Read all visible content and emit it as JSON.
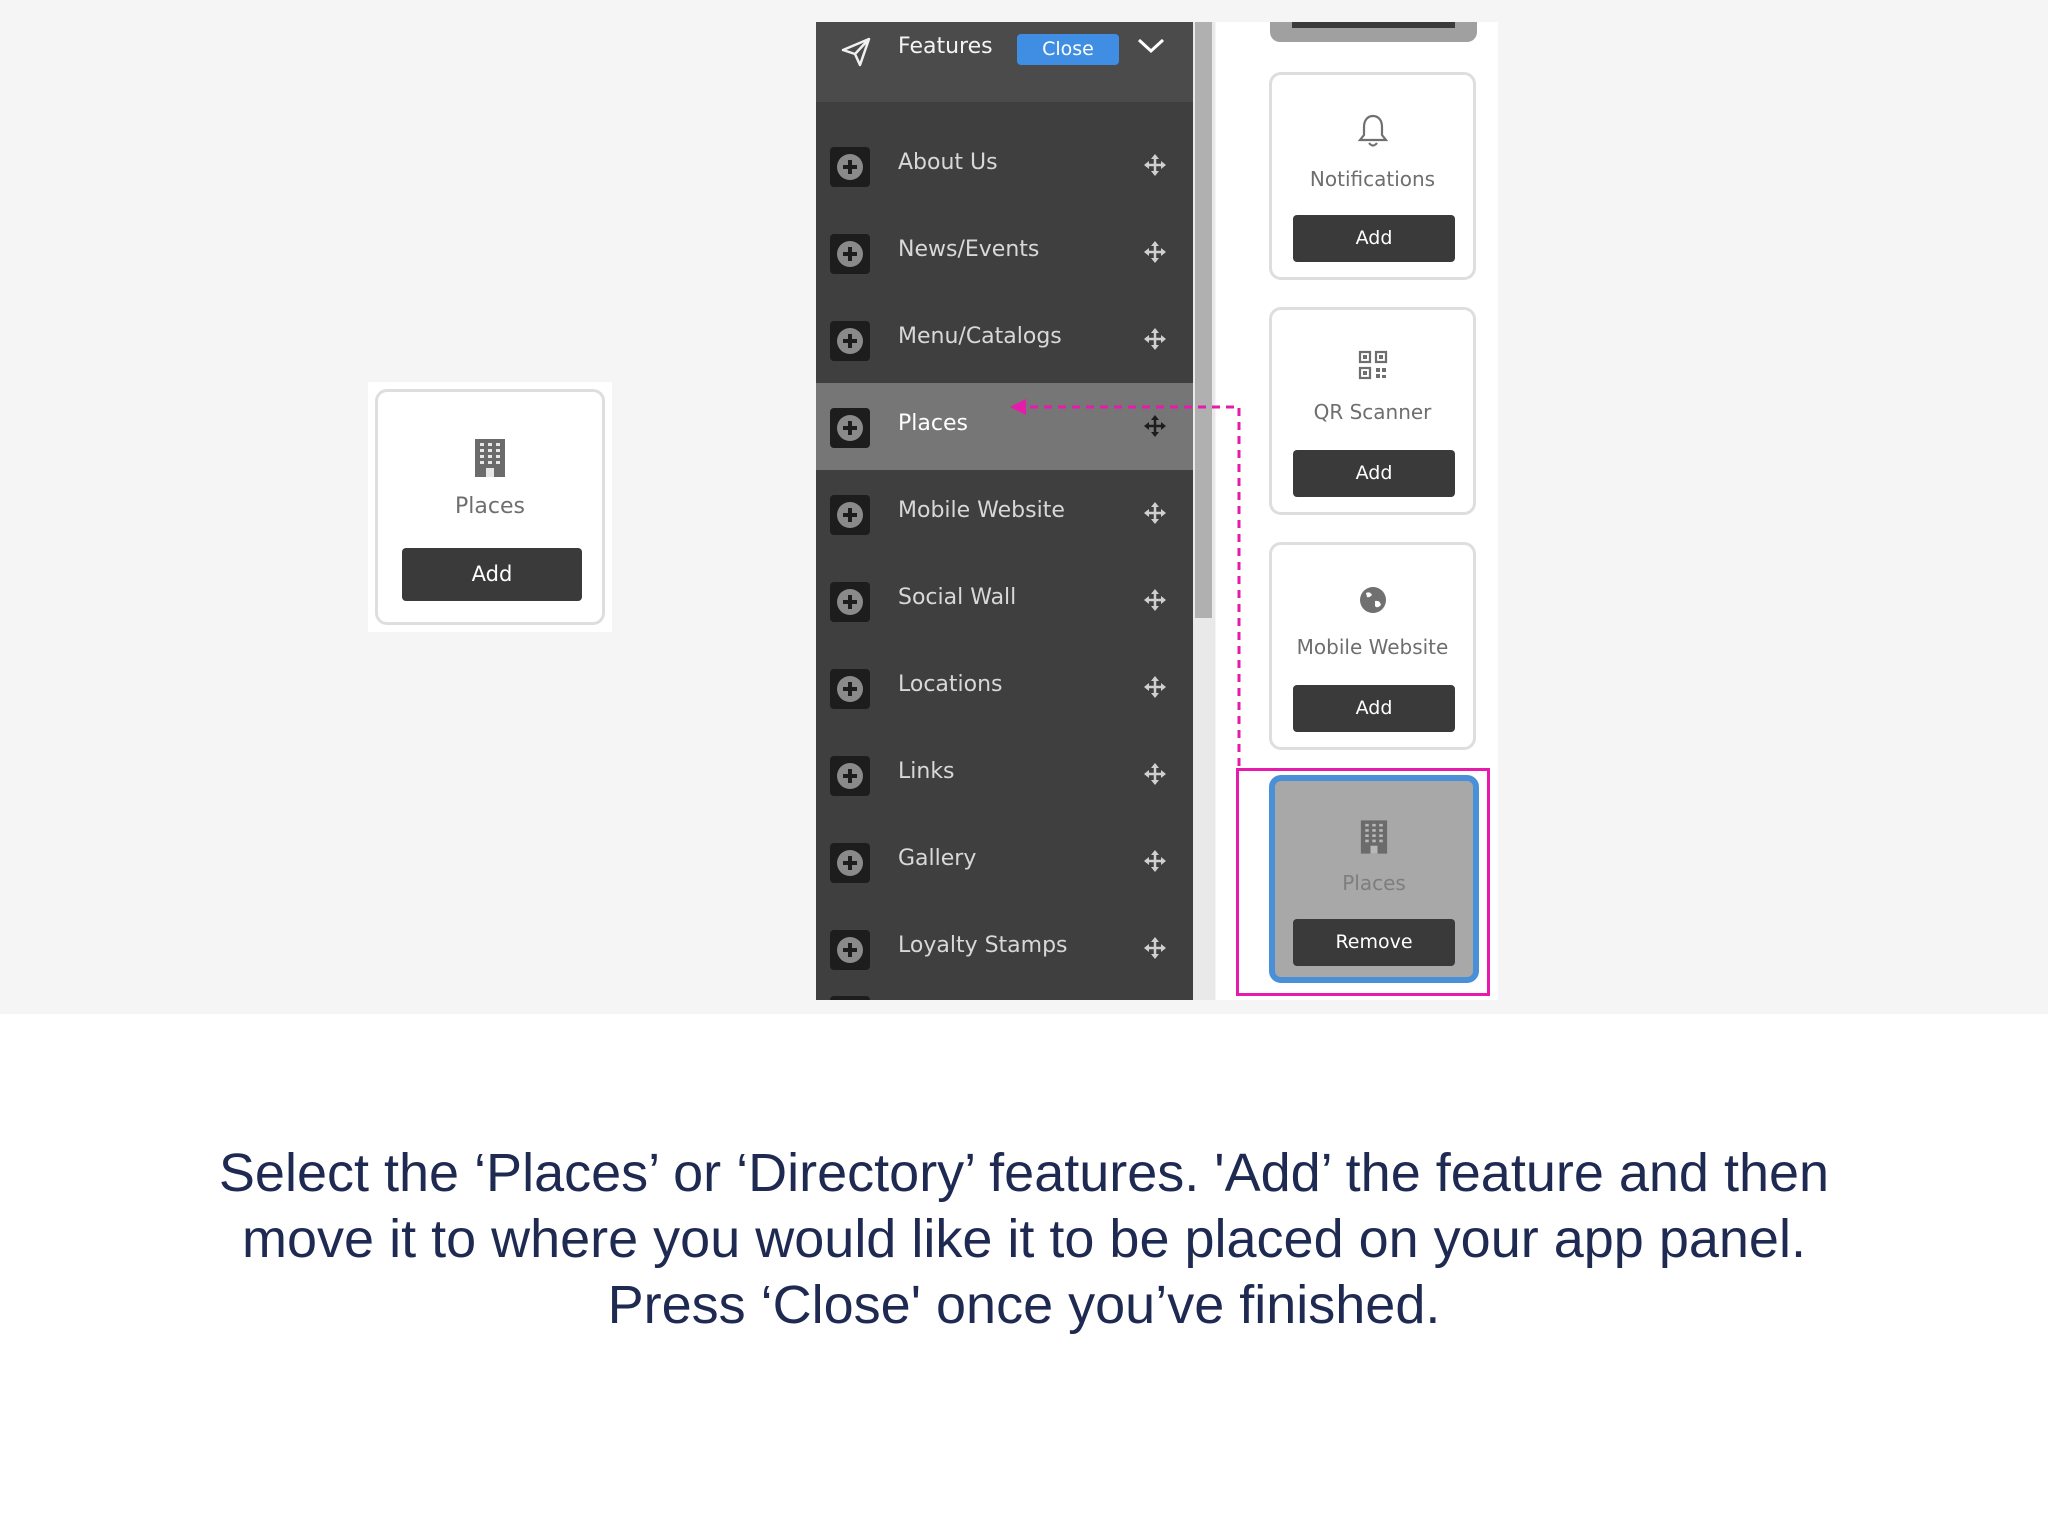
{
  "standalone_card": {
    "label": "Places",
    "button": "Add"
  },
  "menu": {
    "title": "Features",
    "close_label": "Close",
    "items": [
      {
        "label": "About Us"
      },
      {
        "label": "News/Events"
      },
      {
        "label": "Menu/Catalogs"
      },
      {
        "label": "Places",
        "active": true
      },
      {
        "label": "Mobile Website"
      },
      {
        "label": "Social Wall"
      },
      {
        "label": "Locations"
      },
      {
        "label": "Links"
      },
      {
        "label": "Gallery"
      },
      {
        "label": "Loyalty Stamps"
      }
    ]
  },
  "feature_cards": [
    {
      "label": "Notifications",
      "button": "Add",
      "icon": "bell-icon"
    },
    {
      "label": "QR Scanner",
      "button": "Add",
      "icon": "qr-code-icon"
    },
    {
      "label": "Mobile Website",
      "button": "Add",
      "icon": "globe-icon"
    }
  ],
  "placed_card": {
    "label": "Places",
    "button": "Remove",
    "icon": "building-icon"
  },
  "caption": {
    "line1": "Select the ‘Places’ or ‘Directory’ features. 'Add’ the feature and then",
    "line2": "move it to where you would like it to be placed on your app panel.",
    "line3": "Press ‘Close' once you’ve finished."
  },
  "colors": {
    "menu_bg": "#3f3f3f",
    "active_row": "#767676",
    "close_button": "#3f8ee3",
    "highlight": "#e61aab",
    "placed_border": "#4a90d9",
    "caption_text": "#1f2a52"
  }
}
